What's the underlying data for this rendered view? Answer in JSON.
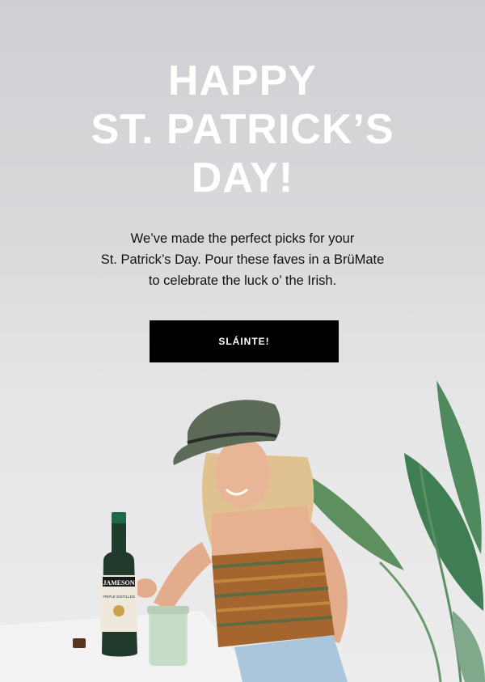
{
  "headline": {
    "line1": "HAPPY",
    "line2": "ST. PATRICK’S",
    "line3": "DAY!"
  },
  "intro": {
    "line1": "We’ve made the perfect picks for your",
    "line2": "St. Patrick’s Day. Pour these faves in a BrüMate",
    "line3": "to celebrate the luck o’ the Irish."
  },
  "cta": {
    "label": "SLÁINTE!"
  },
  "photo": {
    "bottle_label": "JAMESON",
    "bottle_sub": "TRIPLE DISTILLED"
  },
  "colors": {
    "background": "#dcdcdf",
    "headline": "#ffffff",
    "button": "#000000",
    "plant": "#4e8a5e",
    "hat": "#5c6a58",
    "top": "#a4662e"
  }
}
